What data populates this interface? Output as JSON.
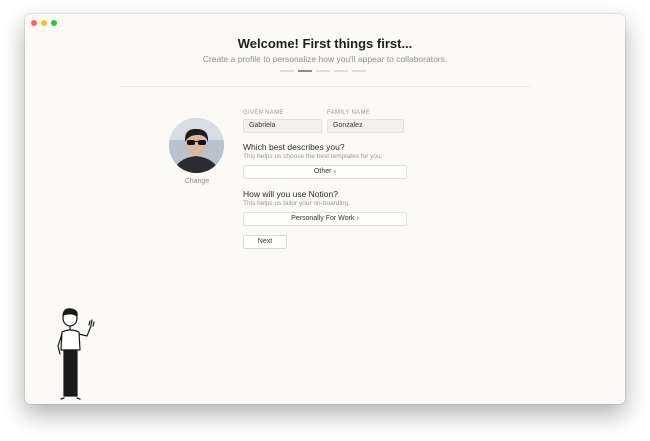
{
  "header": {
    "title": "Welcome! First things first...",
    "subtitle": "Create a profile to personalize how you'll appear to collaborators.",
    "steps_total": 5,
    "step_current": 2
  },
  "profile": {
    "change_label": "Change"
  },
  "form": {
    "given_name_label": "GIVEN NAME",
    "given_name_value": "Gabriela",
    "family_name_label": "FAMILY NAME",
    "family_name_value": "Gonzalez",
    "describe_question": "Which best describes you?",
    "describe_hint": "This helps us choose the best templates for you.",
    "describe_value": "Other",
    "usage_question": "How will you use Notion?",
    "usage_hint": "This helps us tailor your on-boarding.",
    "usage_value": "Personally For Work",
    "next_label": "Next"
  },
  "colors": {
    "window_bg": "#fbfaf7",
    "close": "#fe5f57",
    "minimize": "#febc2e",
    "zoom": "#28c840"
  },
  "icons": [
    "caret-down-icon",
    "waving-person-illustration"
  ]
}
